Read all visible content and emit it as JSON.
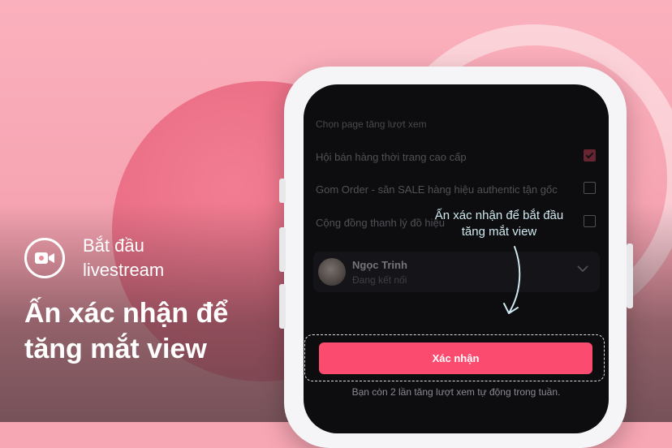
{
  "left": {
    "badge_text": "Bắt đầu livestream",
    "headline": "Ấn xác nhận để tăng mắt view"
  },
  "screen": {
    "section_title": "Chọn page tăng lượt xem",
    "pages": [
      {
        "label": "Hội bán hàng thời trang cao cấp",
        "checked": true
      },
      {
        "label": "Gom Order - săn SALE hàng hiệu authentic tận gốc",
        "checked": false
      },
      {
        "label": "Cộng đồng thanh lý đồ hiệu",
        "checked": false
      }
    ],
    "account": {
      "name": "Ngọc Trinh",
      "sub": "Đang kết nối"
    },
    "confirm_label": "Xác nhận",
    "quota_text": "Bạn còn 2 lần tăng lượt xem tự động trong tuần."
  },
  "hint": {
    "text": "Ấn xác nhận để bắt đầu tăng mắt view"
  },
  "colors": {
    "accent": "#fb4b6f",
    "background": "#f7a6b3",
    "screen": "#17171c"
  }
}
